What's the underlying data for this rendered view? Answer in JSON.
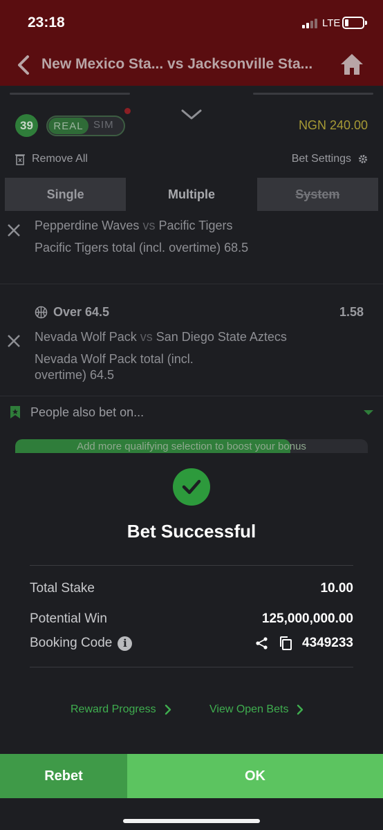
{
  "status": {
    "time": "23:18",
    "network": "LTE"
  },
  "header": {
    "title": "New Mexico Sta... vs Jacksonville Sta..."
  },
  "slip": {
    "count": "39",
    "mode_real": "REAL",
    "mode_sim": "SIM",
    "balance": "NGN 240.00",
    "remove_all": "Remove All",
    "bet_settings": "Bet Settings",
    "tabs": [
      {
        "label": "Single"
      },
      {
        "label": "Multiple"
      },
      {
        "label": "System"
      }
    ],
    "selections": [
      {
        "match_home": "Pepperdine Waves",
        "vs": "vs",
        "match_away": "Pacific Tigers",
        "detail": "Pacific Tigers total (incl. overtime) 68.5"
      },
      {
        "market": "Over 64.5",
        "odds": "1.58",
        "match_home": "Nevada Wolf Pack",
        "vs": "vs",
        "match_away": "San Diego State Aztecs",
        "detail": "Nevada Wolf Pack total (incl. overtime) 64.5"
      }
    ],
    "people_also_bet": "People also bet on...",
    "bonus_text": "Add more qualifying selection to boost your bonus",
    "bonus_progress": 0.78
  },
  "success": {
    "title": "Bet Successful",
    "total_stake_label": "Total Stake",
    "total_stake_value": "10.00",
    "potential_win_label": "Potential Win",
    "potential_win_value": "125,000,000.00",
    "booking_code_label": "Booking Code",
    "booking_code_value": "4349233",
    "reward_progress": "Reward Progress",
    "view_open_bets": "View Open Bets"
  },
  "actions": {
    "rebet": "Rebet",
    "ok": "OK"
  },
  "colors": {
    "header_bg": "#5a0d10",
    "accent_green": "#2d9a3c",
    "ok_green": "#5cc460",
    "rebet_green": "#3f9a48",
    "balance_gold": "#a79a35"
  }
}
